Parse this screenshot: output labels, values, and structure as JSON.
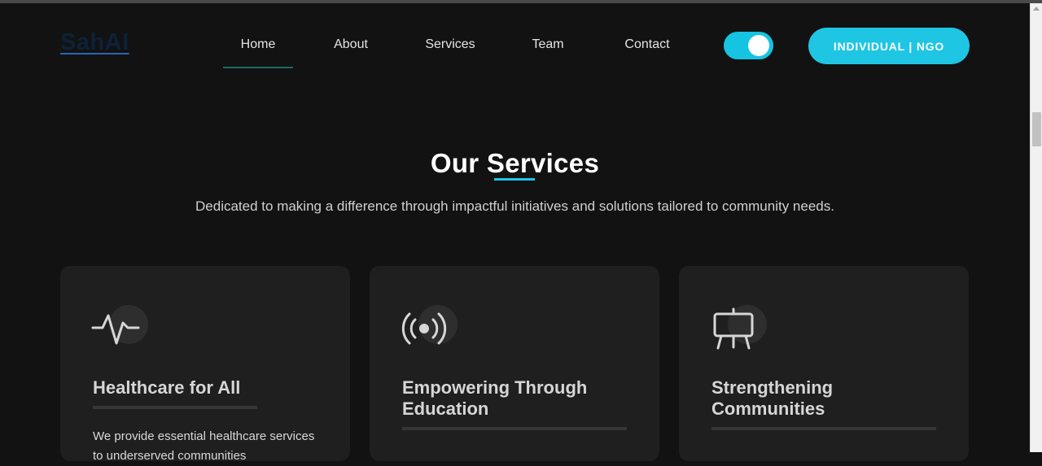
{
  "brand": {
    "logo_text": "SahAI"
  },
  "nav": {
    "items": [
      {
        "label": "Home",
        "active": true
      },
      {
        "label": "About"
      },
      {
        "label": "Services"
      },
      {
        "label": "Team"
      },
      {
        "label": "Contact"
      }
    ],
    "theme_toggle": {
      "state": "on"
    },
    "cta_label": "INDIVIDUAL | NGO"
  },
  "section": {
    "title": "Our Services",
    "subtitle": "Dedicated to making a difference through impactful initiatives and solutions tailored to community needs."
  },
  "cards": [
    {
      "icon": "pulse-icon",
      "title": "Healthcare for All",
      "text": "We provide essential healthcare services to underserved communities"
    },
    {
      "icon": "broadcast-icon",
      "title": "Empowering Through Education",
      "text": ""
    },
    {
      "icon": "easel-icon",
      "title": "Strengthening Communities",
      "text": ""
    }
  ],
  "colors": {
    "accent": "#1ec6e4",
    "background": "#121212",
    "card": "#1f1f1f",
    "logo": "#0d2238"
  }
}
